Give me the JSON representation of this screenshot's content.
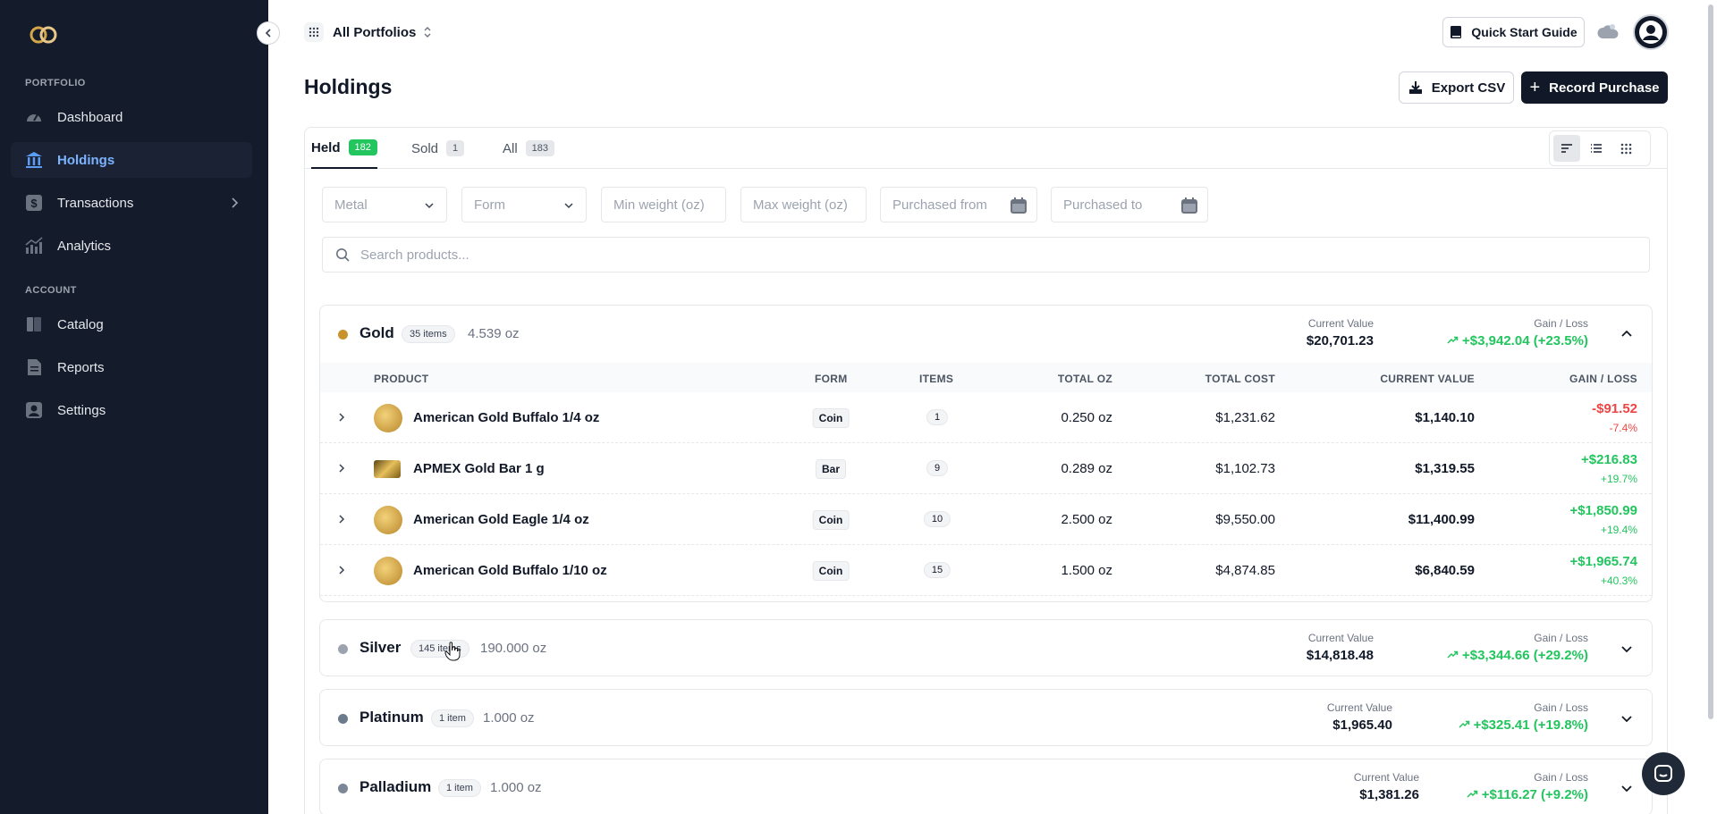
{
  "sidebar": {
    "sections": {
      "portfolio": "PORTFOLIO",
      "account": "ACCOUNT"
    },
    "items": [
      {
        "label": "Dashboard",
        "icon": "gauge-icon"
      },
      {
        "label": "Holdings",
        "icon": "bank-icon"
      },
      {
        "label": "Transactions",
        "icon": "dollar-icon"
      },
      {
        "label": "Analytics",
        "icon": "chart-icon"
      },
      {
        "label": "Catalog",
        "icon": "book-icon"
      },
      {
        "label": "Reports",
        "icon": "document-icon"
      },
      {
        "label": "Settings",
        "icon": "person-icon"
      }
    ]
  },
  "topbar": {
    "portfolio": "All Portfolios",
    "quick_start": "Quick Start Guide"
  },
  "page": {
    "title": "Holdings",
    "export": "Export CSV",
    "record": "Record Purchase"
  },
  "tabs": [
    {
      "label": "Held",
      "count": "182"
    },
    {
      "label": "Sold",
      "count": "1"
    },
    {
      "label": "All",
      "count": "183"
    }
  ],
  "filters": {
    "metal": "Metal",
    "form": "Form",
    "min_weight": "Min weight (oz)",
    "max_weight": "Max weight (oz)",
    "purchased_from": "Purchased from",
    "purchased_to": "Purchased to",
    "search_placeholder": "Search products..."
  },
  "labels": {
    "current_value": "Current Value",
    "gain_loss": "Gain / Loss"
  },
  "table_headers": {
    "product": "PRODUCT",
    "form": "FORM",
    "items": "ITEMS",
    "total_oz": "TOTAL OZ",
    "total_cost": "TOTAL COST",
    "current_value": "CURRENT VALUE",
    "gain_loss": "GAIN / LOSS"
  },
  "groups": [
    {
      "name": "Gold",
      "color": "#c8922a",
      "items": "35 items",
      "oz": "4.539 oz",
      "current_value": "$20,701.23",
      "gain_loss": "+$3,942.04 (+23.5%)"
    },
    {
      "name": "Silver",
      "color": "#9ca3af",
      "items": "145 items",
      "oz": "190.000 oz",
      "current_value": "$14,818.48",
      "gain_loss": "+$3,344.66 (+29.2%)"
    },
    {
      "name": "Platinum",
      "color": "#6b7a8c",
      "items": "1 item",
      "oz": "1.000 oz",
      "current_value": "$1,965.40",
      "gain_loss": "+$325.41 (+19.8%)"
    },
    {
      "name": "Palladium",
      "color": "#7b8797",
      "items": "1 item",
      "oz": "1.000 oz",
      "current_value": "$1,381.26",
      "gain_loss": "+$116.27 (+9.2%)"
    }
  ],
  "gold_rows": [
    {
      "product": "American Gold Buffalo 1/4 oz",
      "form": "Coin",
      "items": "1",
      "total_oz": "0.250 oz",
      "total_cost": "$1,231.62",
      "current_value": "$1,140.10",
      "gain": "-$91.52",
      "pct": "-7.4%",
      "positive": false
    },
    {
      "product": "APMEX Gold Bar 1 g",
      "form": "Bar",
      "items": "9",
      "total_oz": "0.289 oz",
      "total_cost": "$1,102.73",
      "current_value": "$1,319.55",
      "gain": "+$216.83",
      "pct": "+19.7%",
      "positive": true
    },
    {
      "product": "American Gold Eagle 1/4 oz",
      "form": "Coin",
      "items": "10",
      "total_oz": "2.500 oz",
      "total_cost": "$9,550.00",
      "current_value": "$11,400.99",
      "gain": "+$1,850.99",
      "pct": "+19.4%",
      "positive": true
    },
    {
      "product": "American Gold Buffalo 1/10 oz",
      "form": "Coin",
      "items": "15",
      "total_oz": "1.500 oz",
      "total_cost": "$4,874.85",
      "current_value": "$6,840.59",
      "gain": "+$1,965.74",
      "pct": "+40.3%",
      "positive": true
    }
  ]
}
